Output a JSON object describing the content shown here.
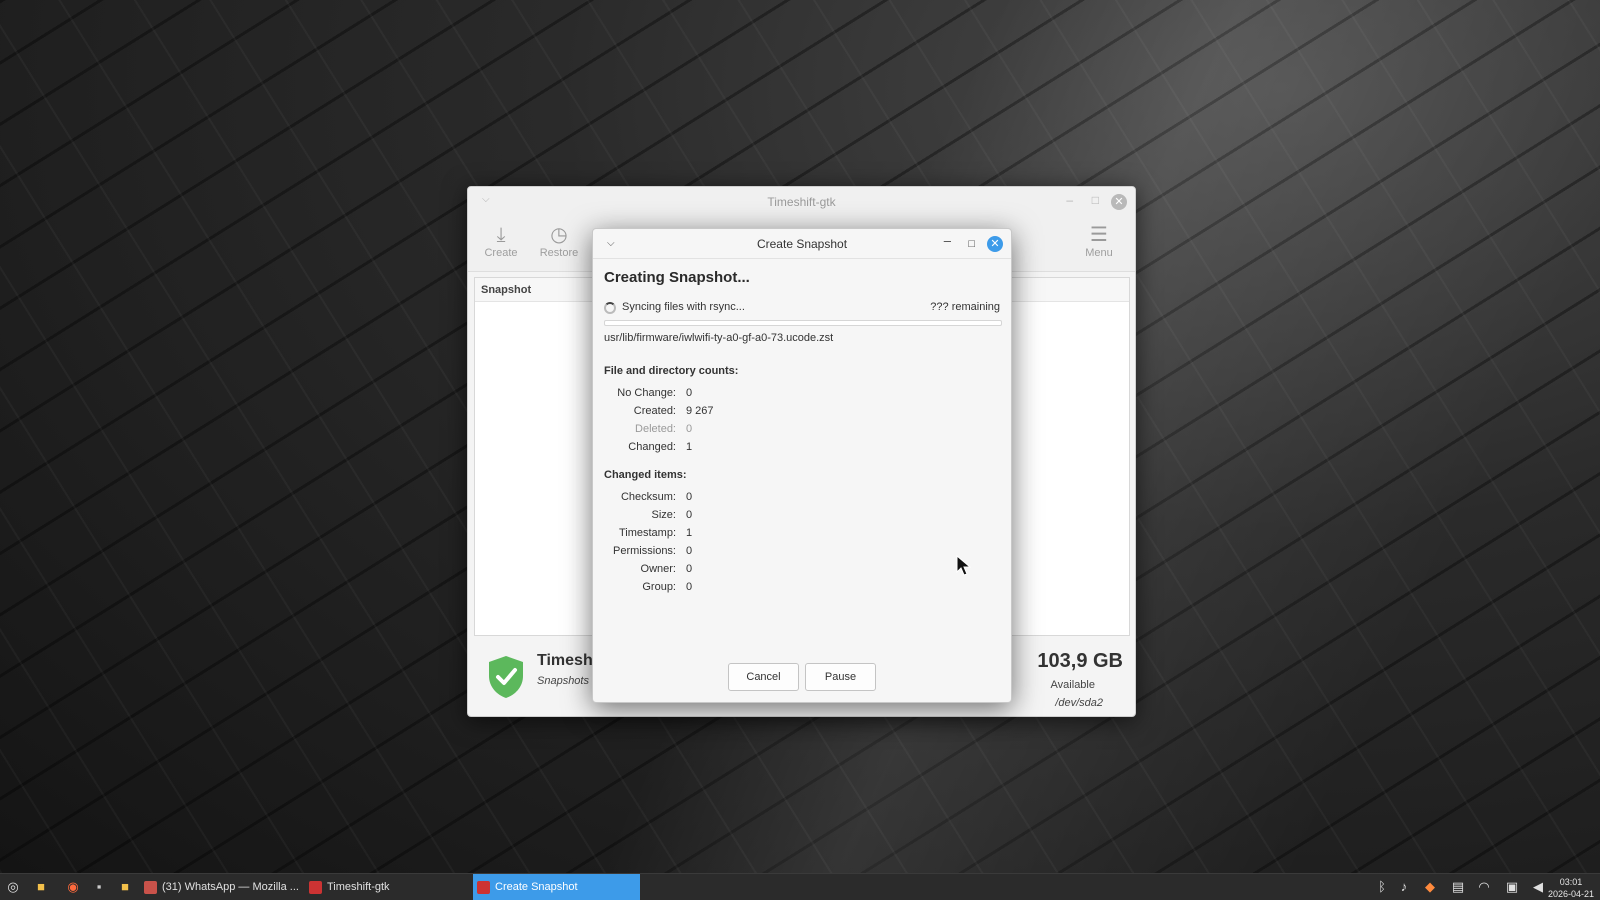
{
  "main_window": {
    "title": "Timeshift-gtk",
    "toolbar": {
      "create_label": "Create",
      "restore_label": "Restore",
      "menu_label": "Menu"
    },
    "list_header": "Snapshot",
    "status": {
      "title": "Timesh",
      "subtitle": "Snapshots v",
      "size": "103,9 GB",
      "available_label": "Available",
      "device": "/dev/sda2"
    }
  },
  "dialog": {
    "title": "Create Snapshot",
    "heading": "Creating Snapshot...",
    "status_text": "Syncing files with rsync...",
    "remaining": "??? remaining",
    "progress": 0,
    "current_file": "usr/lib/firmware/iwlwifi-ty-a0-gf-a0-73.ucode.zst",
    "counts_title": "File and directory counts:",
    "counts": [
      {
        "label": "No Change:",
        "value": "0"
      },
      {
        "label": "Created:",
        "value": "9 267"
      },
      {
        "label": "Deleted:",
        "value": "0"
      },
      {
        "label": "Changed:",
        "value": "1"
      }
    ],
    "changed_title": "Changed items:",
    "changed": [
      {
        "label": "Checksum:",
        "value": "0"
      },
      {
        "label": "Size:",
        "value": "0"
      },
      {
        "label": "Timestamp:",
        "value": "1"
      },
      {
        "label": "Permissions:",
        "value": "0"
      },
      {
        "label": "Owner:",
        "value": "0"
      },
      {
        "label": "Group:",
        "value": "0"
      }
    ],
    "cancel_label": "Cancel",
    "pause_label": "Pause"
  },
  "taskbar": {
    "tasks": [
      {
        "label": "(31) WhatsApp — Mozilla ...",
        "active": false
      },
      {
        "label": "Timeshift-gtk",
        "active": false
      },
      {
        "label": "Create Snapshot",
        "active": true
      }
    ],
    "clock_time": "03:01",
    "clock_date": "2026-04-21"
  },
  "colors": {
    "accent": "#3d9be9",
    "shield_green": "#5cb85c"
  }
}
